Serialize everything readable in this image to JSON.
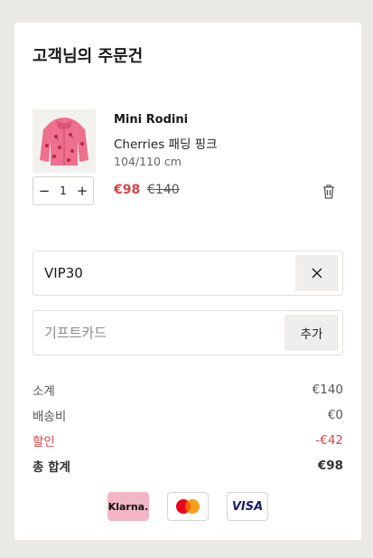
{
  "header": {
    "title": "고객님의 주문건"
  },
  "item": {
    "brand": "Mini Rodini",
    "name": "Cherries 패딩 핑크",
    "size": "104/110 cm",
    "quantity": "1",
    "minus": "−",
    "plus": "+",
    "price": "€98",
    "original_price": "€140",
    "image_alt": "pink padded jacket with cherry print"
  },
  "coupon": {
    "value": "VIP30"
  },
  "giftcard": {
    "placeholder": "기프트카드",
    "add_label": "추가"
  },
  "summary": {
    "subtotal_label": "소계",
    "subtotal_value": "€140",
    "shipping_label": "배송비",
    "shipping_value": "€0",
    "discount_label": "할인",
    "discount_value": "-€42",
    "total_label": "총 합계",
    "total_value": "€98"
  },
  "payments": {
    "klarna_label": "Klarna.",
    "mastercard_icon": "mastercard-icon",
    "visa_label": "VISA"
  },
  "colors": {
    "accent_red": "#d64545",
    "klarna_pink": "#f4b6c7",
    "background": "#ebe9e5"
  }
}
